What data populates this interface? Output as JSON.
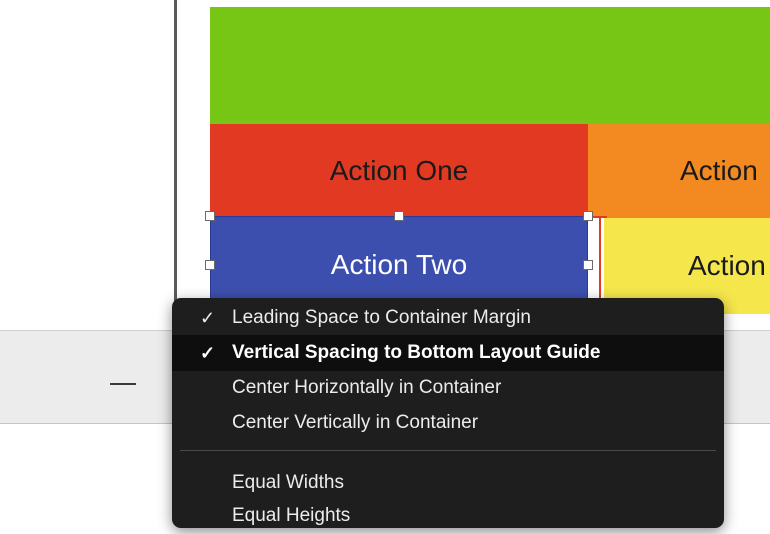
{
  "canvas": {
    "buttons": [
      {
        "label": "Action One"
      },
      {
        "label": "Action Two"
      },
      {
        "label": "Action"
      },
      {
        "label": "Action"
      }
    ]
  },
  "colors": {
    "green": "#77c514",
    "red": "#e23a22",
    "orange": "#f28a21",
    "blue": "#3d4fae",
    "yellow": "#f5e64b",
    "menu_bg": "#1e1e1e"
  },
  "context_menu": {
    "items": [
      {
        "check": "✓",
        "label": "Leading Space to Container Margin"
      },
      {
        "check": "✓",
        "label": "Vertical Spacing to Bottom Layout Guide"
      },
      {
        "check": "",
        "label": "Center Horizontally in Container"
      },
      {
        "check": "",
        "label": "Center Vertically in Container"
      },
      {
        "check": "",
        "label": "Equal Widths"
      },
      {
        "check": "",
        "label": "Equal Heights"
      }
    ]
  }
}
